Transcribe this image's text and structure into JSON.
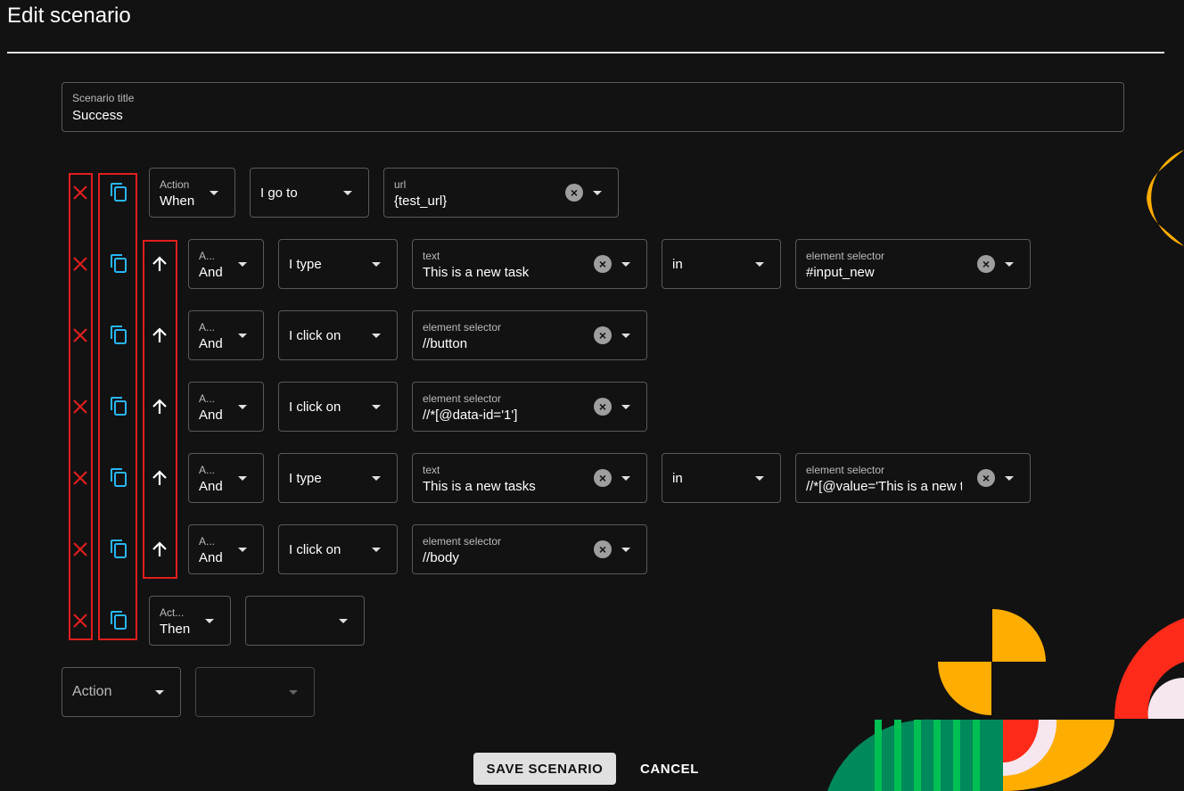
{
  "page": {
    "title": "Edit scenario"
  },
  "scenario_title": {
    "label": "Scenario title",
    "value": "Success"
  },
  "rows": {
    "r0": {
      "action_label": "Action",
      "action": "When",
      "step": "I go to",
      "p1_label": "url",
      "p1_value": "{test_url}"
    },
    "r1": {
      "action_label": "A...",
      "action": "And",
      "step": "I type",
      "p1_label": "text",
      "p1_value": "This is a new task",
      "connector": "in",
      "p2_label": "element selector",
      "p2_value": "#input_new"
    },
    "r2": {
      "action_label": "A...",
      "action": "And",
      "step": "I click on",
      "p1_label": "element selector",
      "p1_value": "//button"
    },
    "r3": {
      "action_label": "A...",
      "action": "And",
      "step": "I click on",
      "p1_label": "element selector",
      "p1_value": "//*[@data-id='1']"
    },
    "r4": {
      "action_label": "A...",
      "action": "And",
      "step": "I type",
      "p1_label": "text",
      "p1_value": "This is a new tasks",
      "connector": "in",
      "p2_label": "element selector",
      "p2_value": "//*[@value='This is a new ta"
    },
    "r5": {
      "action_label": "A...",
      "action": "And",
      "step": "I click on",
      "p1_label": "element selector",
      "p1_value": "//body"
    },
    "r6": {
      "action_label": "Act...",
      "action": "Then",
      "step": ""
    }
  },
  "new_step": {
    "action_placeholder": "Action",
    "step": ""
  },
  "buttons": {
    "save": "SAVE SCENARIO",
    "cancel": "CANCEL"
  },
  "icons": {
    "delete": "close-icon",
    "copy": "copy-icon",
    "move_up": "arrow-up-icon",
    "dropdown": "arrow-drop-down-icon",
    "clear": "clear-icon"
  },
  "colors": {
    "background": "#121212",
    "delete": "#e01e1e",
    "copy": "#29b6f6",
    "highlight_box": "#e01e1e",
    "deco_orange": "#ffad00",
    "deco_red": "#ff2a1a",
    "deco_green": "#00895a",
    "deco_green_light": "#00c054",
    "deco_pink": "#f5e6f0"
  }
}
